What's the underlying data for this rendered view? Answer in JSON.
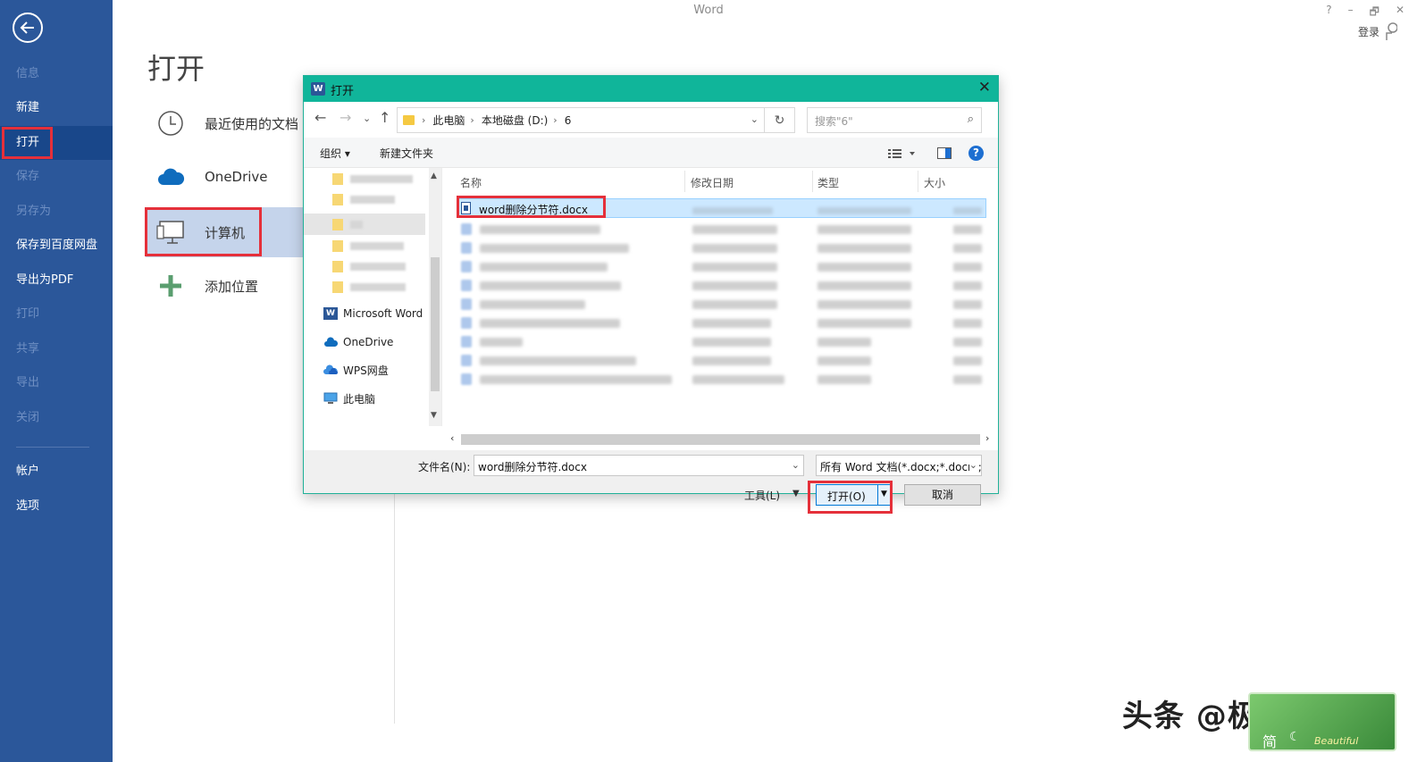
{
  "window": {
    "title": "Word",
    "controls": [
      "?",
      "–",
      "🗗",
      "✕"
    ],
    "sign_in": "登录"
  },
  "sidebar": {
    "items": [
      {
        "label": "信息",
        "enabled": false
      },
      {
        "label": "新建",
        "enabled": true
      },
      {
        "label": "打开",
        "enabled": true,
        "active": true
      },
      {
        "label": "保存",
        "enabled": false
      },
      {
        "label": "另存为",
        "enabled": false
      },
      {
        "label": "保存到百度网盘",
        "enabled": true
      },
      {
        "label": "导出为PDF",
        "enabled": true
      },
      {
        "label": "打印",
        "enabled": false
      },
      {
        "label": "共享",
        "enabled": false
      },
      {
        "label": "导出",
        "enabled": false
      },
      {
        "label": "关闭",
        "enabled": false
      }
    ],
    "footer_items": [
      {
        "label": "帐户"
      },
      {
        "label": "选项"
      }
    ]
  },
  "main": {
    "title": "打开",
    "places": [
      {
        "label": "最近使用的文档",
        "icon": "clock-icon"
      },
      {
        "label": "OneDrive",
        "icon": "cloud-icon"
      },
      {
        "label": "计算机",
        "icon": "computer-icon",
        "selected": true
      },
      {
        "label": "添加位置",
        "icon": "plus-icon"
      }
    ]
  },
  "dialog": {
    "title": "打开",
    "breadcrumb": [
      "此电脑",
      "本地磁盘 (D:)",
      "6"
    ],
    "search_placeholder": "搜索\"6\"",
    "toolbar": {
      "organize": "组织 ▾",
      "new_folder": "新建文件夹",
      "help": "?"
    },
    "nav_tree": [
      {
        "label": "Microsoft Word",
        "icon": "word-icon"
      },
      {
        "label": "OneDrive",
        "icon": "cloud-icon"
      },
      {
        "label": "WPS网盘",
        "icon": "wps-cloud-icon"
      },
      {
        "label": "此电脑",
        "icon": "pc-icon"
      }
    ],
    "columns": [
      "名称",
      "修改日期",
      "类型",
      "大小"
    ],
    "selected_file": "word删除分节符.docx",
    "filename_label": "文件名(N):",
    "filename_value": "word删除分节符.docx",
    "file_type_filter": "所有 Word 文档(*.docx;*.docm;*.dotx;*.dotm;*.doc;*.dot)",
    "tools_label": "工具(L)",
    "open_button": "打开(O)",
    "cancel_button": "取消"
  },
  "watermark": {
    "text": "头条 @极速手助",
    "badge_char": "简",
    "badge_script": "Beautiful"
  },
  "colors": {
    "sidebar": "#2b579a",
    "dialog_title_bar": "#10b59a",
    "highlight_box": "#e5303a",
    "selected_row": "#cce8ff"
  }
}
